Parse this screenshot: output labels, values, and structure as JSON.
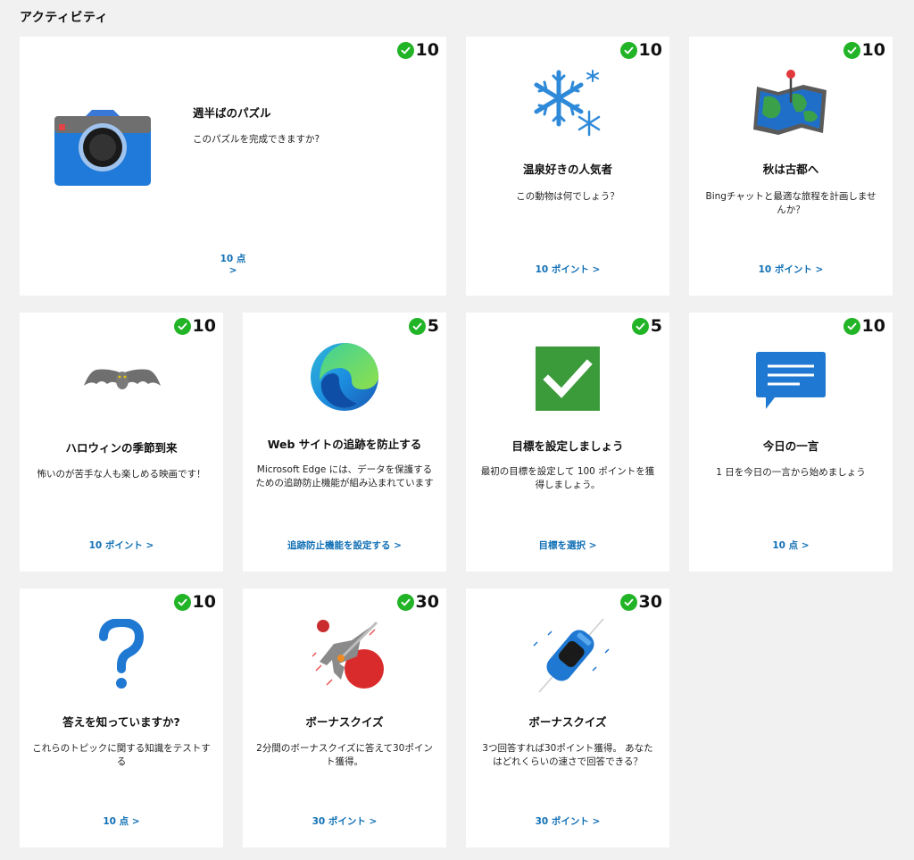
{
  "section": {
    "title": "アクティビティ"
  },
  "cards": [
    {
      "points": "10",
      "title": "週半ばのパズル",
      "desc": "このパズルを完成できますか?",
      "link": "10 点 >",
      "icon": "camera-icon"
    },
    {
      "points": "10",
      "title": "温泉好きの人気者",
      "desc": "この動物は何でしょう？",
      "link": "10 ポイント >",
      "icon": "snowflake-icon"
    },
    {
      "points": "10",
      "title": "秋は古都へ",
      "desc": "Bingチャットと最適な旅程を計画しませんか？",
      "link": "10 ポイント >",
      "icon": "map-icon"
    },
    {
      "points": "10",
      "title": "ハロウィンの季節到来",
      "desc": "怖いのが苦手な人も楽しめる映画です！",
      "link": "10 ポイント >",
      "icon": "bat-icon"
    },
    {
      "points": "5",
      "title": "Web サイトの追跡を防止する",
      "desc": "Microsoft Edge には、データを保護するための追跡防止機能が組み込まれています",
      "link": "追跡防止機能を設定する >",
      "icon": "edge-logo-icon"
    },
    {
      "points": "5",
      "title": "目標を設定しましょう",
      "desc": "最初の目標を設定して 100 ポイントを獲得しましょう。",
      "link": "目標を選択 >",
      "icon": "checkmark-icon"
    },
    {
      "points": "10",
      "title": "今日の一言",
      "desc": "1 日を今日の一言から始めましょう",
      "link": "10 点 >",
      "icon": "chat-bubble-icon"
    },
    {
      "points": "10",
      "title": "答えを知っていますか?",
      "desc": "これらのトピックに関する知識をテストする",
      "link": "10 点 >",
      "icon": "question-mark-icon"
    },
    {
      "points": "30",
      "title": "ボーナスクイズ",
      "desc": "2分間のボーナスクイズに答えて30ポイント獲得。",
      "link": "30 ポイント >",
      "icon": "spaceship-icon"
    },
    {
      "points": "30",
      "title": "ボーナスクイズ",
      "desc": "3つ回答すれば30ポイント獲得。 あなたはどれくらいの速さで回答できる？",
      "link": "30 ポイント >",
      "icon": "race-car-icon"
    }
  ],
  "colors": {
    "accent_link": "#1170b5",
    "check_green": "#22b427",
    "background": "#f1f1f1"
  }
}
